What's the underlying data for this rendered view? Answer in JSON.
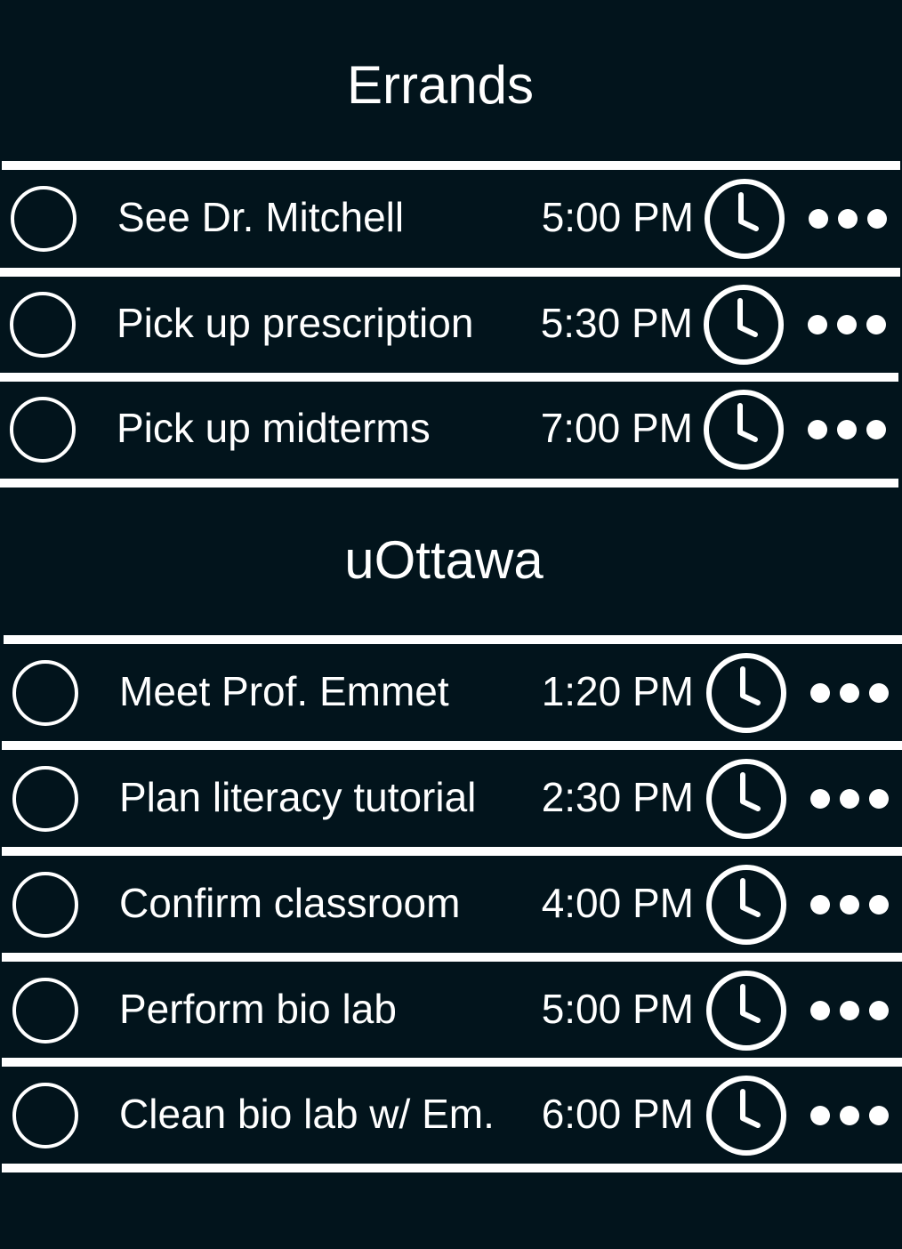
{
  "sections": [
    {
      "title": "Errands",
      "tasks": [
        {
          "name": "See Dr. Mitchell",
          "time": "5:00 PM"
        },
        {
          "name": "Pick up prescription",
          "time": "5:30 PM"
        },
        {
          "name": "Pick up midterms",
          "time": "7:00 PM"
        }
      ]
    },
    {
      "title": "uOttawa",
      "tasks": [
        {
          "name": "Meet Prof. Emmet",
          "time": "1:20 PM"
        },
        {
          "name": "Plan literacy tutorial",
          "time": "2:30 PM"
        },
        {
          "name": "Confirm classroom",
          "time": "4:00 PM"
        },
        {
          "name": "Perform bio lab",
          "time": "5:00 PM"
        },
        {
          "name": "Clean bio lab w/ Em.",
          "time": "6:00 PM"
        }
      ]
    }
  ],
  "icons": {
    "checkbox": "circle-checkbox-icon",
    "reminder": "clock-icon",
    "more": "more-dots-icon"
  },
  "colors": {
    "background": "#02141c",
    "foreground": "#ffffff"
  }
}
